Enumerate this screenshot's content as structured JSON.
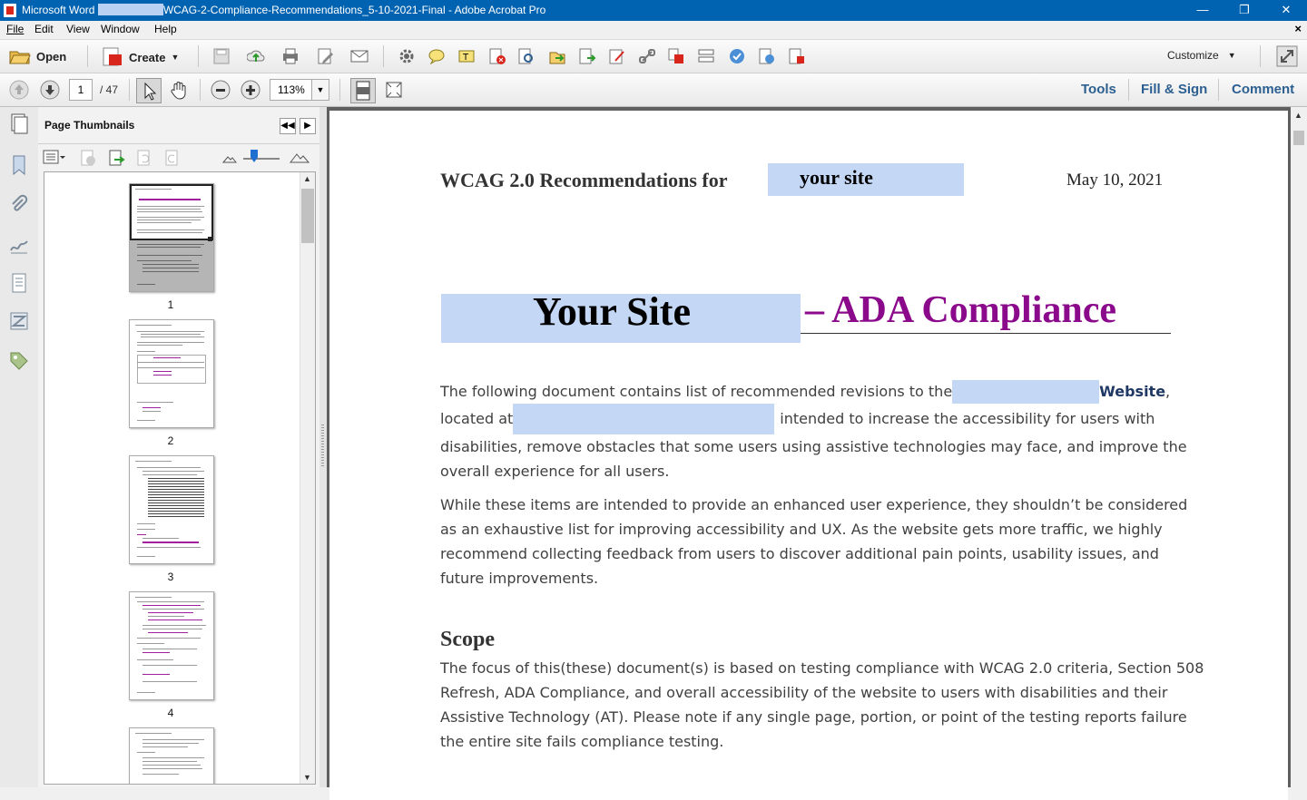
{
  "window": {
    "title_prefix": "Microsoft Word",
    "title_suffix": "WCAG-2-Compliance-Recommendations_5-10-2021-Final - Adobe Acrobat Pro",
    "minimize": "—",
    "maximize": "❐",
    "close": "✕"
  },
  "menu": [
    "File",
    "Edit",
    "View",
    "Window",
    "Help"
  ],
  "menu_close": "×",
  "toolbar": {
    "open_label": "Open",
    "create_label": "Create",
    "customize_label": "Customize"
  },
  "nav": {
    "page_current": "1",
    "page_total": "/ 47",
    "zoom": "113%"
  },
  "panels": {
    "tools": "Tools",
    "fill_sign": "Fill & Sign",
    "comment": "Comment"
  },
  "thumbnails": {
    "title": "Page Thumbnails",
    "pages": [
      "1",
      "2",
      "3",
      "4"
    ]
  },
  "document": {
    "header_title": "WCAG 2.0 Recommendations for",
    "header_highlight": "your site",
    "header_date": "May 10, 2021",
    "big_title_site": "Your Site",
    "big_title_rest": "– ADA Compliance",
    "p1_a": "The following document contains list of recommended revisions to the",
    "p1_website": "Website",
    "p1_comma": ",",
    "p1_b": "located at",
    "p1_c": "intended to increase the accessibility for users with",
    "p1_d": "disabilities, remove obstacles that some users using assistive technologies may face, and improve the",
    "p1_e": "overall experience for all users.",
    "p2_lines": [
      "While these items are intended to provide an enhanced user experience, they shouldn’t be considered",
      "as an exhaustive list for improving accessibility and UX. As the website gets more traffic, we highly",
      "recommend collecting feedback from users to discover additional pain points, usability issues, and",
      "future improvements."
    ],
    "scope_heading": "Scope",
    "scope_lines": [
      "The focus of this(these) document(s) is based on testing compliance with WCAG 2.0 criteria, Section 508",
      "Refresh, ADA Compliance, and overall accessibility of the website to users with disabilities and their",
      "Assistive Technology (AT).  Please note if any single page, portion, or point of the testing reports failure",
      "the entire site fails compliance testing."
    ]
  },
  "colors": {
    "titlebar": "#0063b1",
    "highlight": "#c4d7f5",
    "ada_purple": "#8b0a8b",
    "link_blue": "#1f3864"
  }
}
